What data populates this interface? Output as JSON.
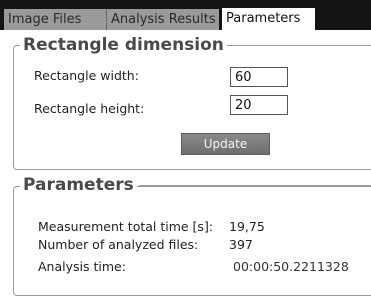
{
  "tabs": [
    {
      "label": "Image Files"
    },
    {
      "label": "Analysis Results"
    },
    {
      "label": "Parameters"
    }
  ],
  "rect_group": {
    "title": "Rectangle dimension",
    "width_label": "Rectangle width:",
    "width_value": "60",
    "height_label": "Rectangle height:",
    "height_value": "20",
    "update_label": "Update"
  },
  "params_group": {
    "title": "Parameters",
    "rows": [
      {
        "label": "Measurement total time [s]:",
        "value": "19,75"
      },
      {
        "label": "Number of analyzed files:",
        "value": "397"
      },
      {
        "label": "Analysis time:",
        "value": "00:00:50.2211328"
      }
    ]
  }
}
